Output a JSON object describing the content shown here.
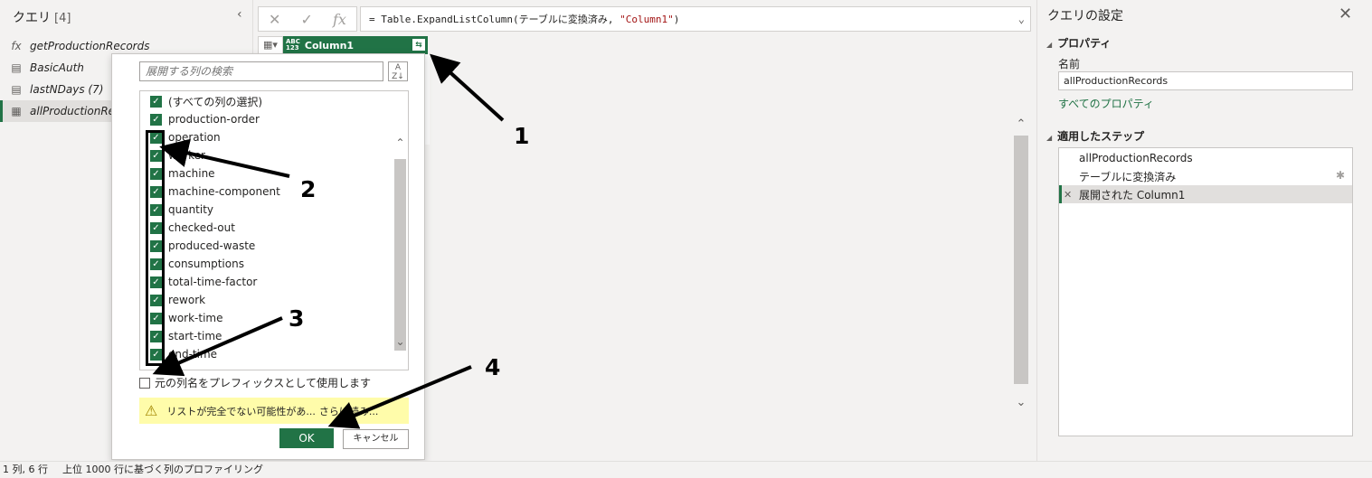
{
  "queries": {
    "title": "クエリ",
    "count": "[4]",
    "collapse_icon": "chevron-left-icon",
    "items": [
      {
        "icon": "fx",
        "label": "getProductionRecords"
      },
      {
        "icon": "table",
        "label": "BasicAuth"
      },
      {
        "icon": "table",
        "label": "lastNDays (7)"
      },
      {
        "icon": "table",
        "label": "allProductionRec"
      }
    ]
  },
  "formula": {
    "cancel_icon": "✕",
    "commit_icon": "✓",
    "fx_label": "fx",
    "prefix": "= Table.ExpandListColumn(テーブルに変換済み, ",
    "string": "\"Column1\"",
    "suffix": ")"
  },
  "grid": {
    "column_type": "ABC\n123",
    "column_name": "Column1"
  },
  "expand_dialog": {
    "search_placeholder": "展開する列の検索",
    "select_all": "(すべての列の選択)",
    "columns": [
      "production-order",
      "operation",
      "worker",
      "machine",
      "machine-component",
      "quantity",
      "checked-out",
      "produced-waste",
      "consumptions",
      "total-time-factor",
      "rework",
      "work-time",
      "start-time",
      "end-time"
    ],
    "prefix_label": "元の列名をプレフィックスとして使用します",
    "warning_text": "リストが完全でない可能性があ...",
    "load_more": "さらに読み...",
    "ok_label": "OK",
    "cancel_label": "キャンセル"
  },
  "settings": {
    "title": "クエリの設定",
    "properties_header": "プロパティ",
    "name_label": "名前",
    "name_value": "allProductionRecords",
    "all_properties_link": "すべてのプロパティ",
    "steps_header": "適用したステップ",
    "steps": [
      "allProductionRecords",
      "テーブルに変換済み",
      "展開された Column1"
    ]
  },
  "status": {
    "rows_cols": "1 列, 6 行",
    "profiling": "上位 1000 行に基づく列のプロファイリング"
  },
  "annotations": [
    "1",
    "2",
    "3",
    "4"
  ]
}
